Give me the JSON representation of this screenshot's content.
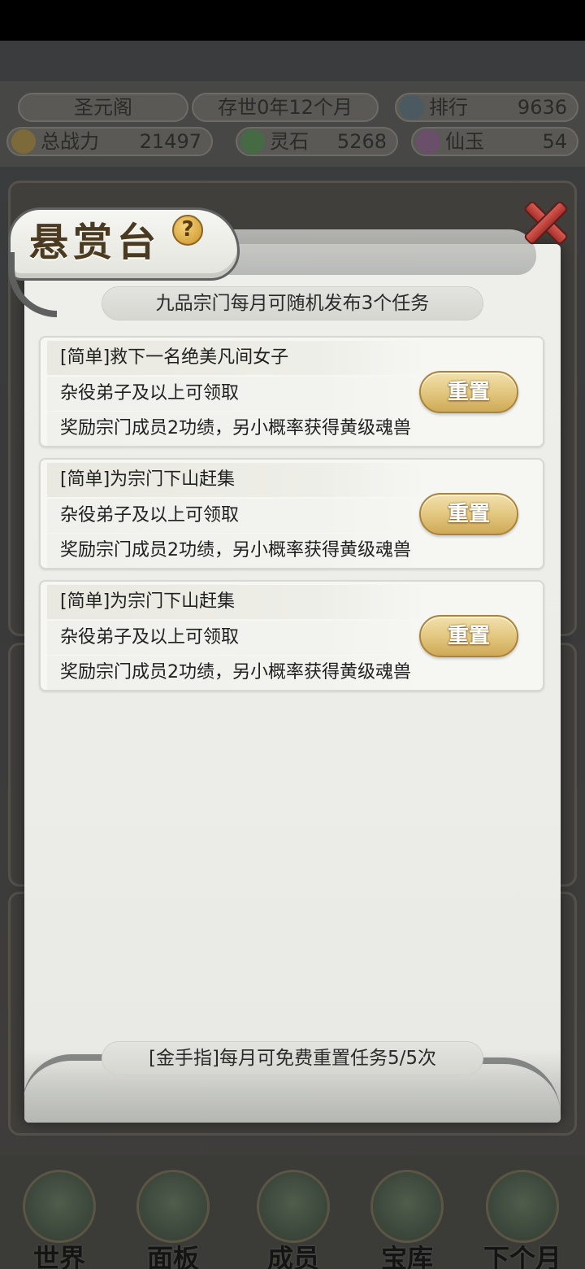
{
  "hud": {
    "sect_name": "圣元阁",
    "time": "存世0年12个月",
    "rank_label": "排行",
    "rank_value": "9636",
    "power_label": "总战力",
    "power_value": "21497",
    "spirit_stone_label": "灵石",
    "spirit_stone_value": "5268",
    "jade_label": "仙玉",
    "jade_value": "54"
  },
  "modal": {
    "title": "悬赏台",
    "help_glyph": "?",
    "info": "九品宗门每月可随机发布3个任务",
    "footer": "[金手指]每月可免费重置任务5/5次",
    "tasks": [
      {
        "title": "[简单]救下一名绝美凡间女子",
        "requirement": "杂役弟子及以上可领取",
        "reward": "奖励宗门成员2功绩，另小概率获得黄级魂兽",
        "button": "重置"
      },
      {
        "title": "[简单]为宗门下山赶集",
        "requirement": "杂役弟子及以上可领取",
        "reward": "奖励宗门成员2功绩，另小概率获得黄级魂兽",
        "button": "重置"
      },
      {
        "title": "[简单]为宗门下山赶集",
        "requirement": "杂役弟子及以上可领取",
        "reward": "奖励宗门成员2功绩，另小概率获得黄级魂兽",
        "button": "重置"
      }
    ]
  },
  "nav": {
    "items": [
      {
        "label": "世界",
        "icon": "world-icon"
      },
      {
        "label": "面板",
        "icon": "panel-icon"
      },
      {
        "label": "成员",
        "icon": "members-icon"
      },
      {
        "label": "宝库",
        "icon": "treasury-icon"
      },
      {
        "label": "下个月",
        "icon": "next-month-icon"
      }
    ]
  },
  "colors": {
    "reset_button": "#e1c57c",
    "title_text": "#4a3a22",
    "close_red": "#c0413a"
  }
}
